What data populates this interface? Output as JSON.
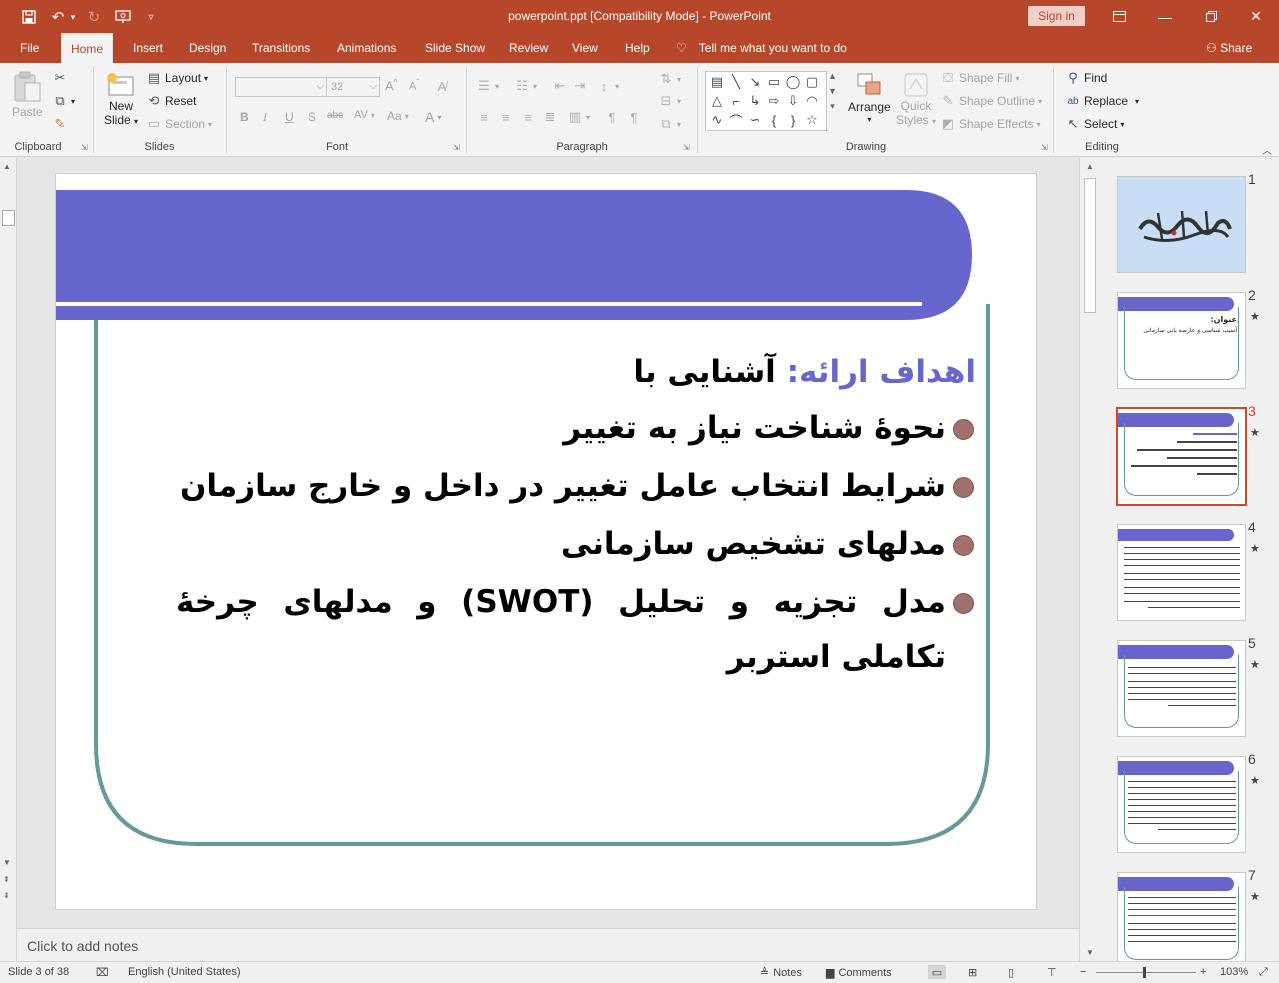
{
  "titlebar": {
    "title": "powerpoint.ppt [Compatibility Mode]  -  PowerPoint",
    "signin": "Sign in"
  },
  "tabs": [
    "File",
    "Home",
    "Insert",
    "Design",
    "Transitions",
    "Animations",
    "Slide Show",
    "Review",
    "View",
    "Help"
  ],
  "active_tab": "Home",
  "tellme": "Tell me what you want to do",
  "share": "Share",
  "ribbon": {
    "clipboard": {
      "label": "Clipboard",
      "paste": "Paste"
    },
    "slides": {
      "label": "Slides",
      "new_slide_1": "New",
      "new_slide_2": "Slide",
      "layout": "Layout",
      "reset": "Reset",
      "section": "Section"
    },
    "font": {
      "label": "Font",
      "font_name": "",
      "font_size": "32"
    },
    "paragraph": {
      "label": "Paragraph"
    },
    "drawing": {
      "label": "Drawing",
      "arrange": "Arrange",
      "quick_styles_1": "Quick",
      "quick_styles_2": "Styles",
      "shape_fill": "Shape Fill",
      "shape_outline": "Shape Outline",
      "shape_effects": "Shape Effects"
    },
    "editing": {
      "label": "Editing",
      "find": "Find",
      "replace": "Replace",
      "select": "Select"
    }
  },
  "slide": {
    "title_accent": "اهداف ارائه:",
    "title_rest": " آشنایی با",
    "bullets": [
      "نحوۀ شناخت نیاز به تغییر",
      "شرایط انتخاب عامل تغییر در داخل و خارج سازمان",
      "مدلهای تشخیص سازمانی",
      "مدل تجزیه و تحلیل (SWOT) و مدلهای چرخۀ"
    ],
    "bullet_continuation": "تکاملی استربر"
  },
  "notes_placeholder": "Click to add notes",
  "thumbnails": [
    {
      "num": "1",
      "star": ""
    },
    {
      "num": "2",
      "star": "★"
    },
    {
      "num": "3",
      "star": "★"
    },
    {
      "num": "4",
      "star": "★"
    },
    {
      "num": "5",
      "star": "★"
    },
    {
      "num": "6",
      "star": "★"
    },
    {
      "num": "7",
      "star": "★"
    }
  ],
  "thumb2_title": "عنوان:",
  "thumb2_sub": "آسیب شناسی و عارضه یابی سازمانی",
  "selected_slide": 3,
  "statusbar": {
    "slide_info": "Slide 3 of 38",
    "language": "English (United States)",
    "notes": "Notes",
    "comments": "Comments",
    "zoom": "103%"
  },
  "colors": {
    "accent": "#b7472a",
    "slide_band": "#6666cc",
    "slide_frame": "#669999",
    "bullet": "#a0706b"
  },
  "icons": [
    "save-icon",
    "undo-icon",
    "redo-icon",
    "present-icon",
    "customize-icon",
    "ribbon-display-icon",
    "minimize-icon",
    "restore-icon",
    "close-icon",
    "lightbulb-icon",
    "person-icon"
  ]
}
